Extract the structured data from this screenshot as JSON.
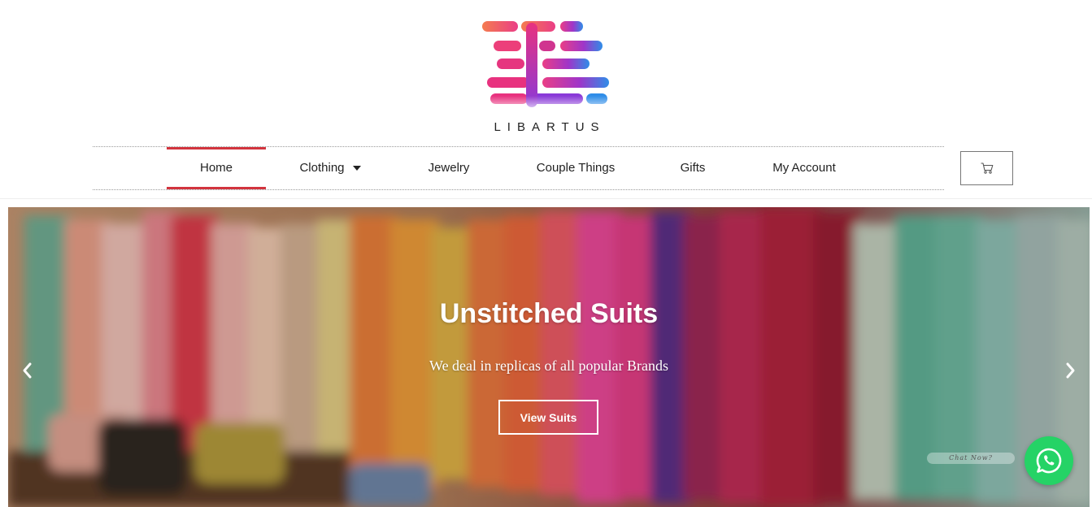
{
  "brand": {
    "name": "LIBARTUS",
    "logo_icon": "libartus-logo-icon",
    "colors": {
      "pink": "#e8327f",
      "purple": "#7b3fe0",
      "blue": "#2f8de8",
      "orange": "#f47b4f"
    }
  },
  "nav": {
    "items": [
      {
        "label": "Home",
        "active": true
      },
      {
        "label": "Clothing",
        "has_dropdown": true
      },
      {
        "label": "Jewelry"
      },
      {
        "label": "Couple Things"
      },
      {
        "label": "Gifts"
      },
      {
        "label": "My Account"
      }
    ],
    "active_color": "#d2343e",
    "cart_icon": "cart-icon"
  },
  "hero": {
    "title": "Unstitched Suits",
    "subtitle": "We deal in replicas of all popular Brands",
    "button_label": "View Suits",
    "prev_icon": "chevron-left-icon",
    "next_icon": "chevron-right-icon"
  },
  "chat": {
    "label": "Chat Now?",
    "icon": "whatsapp-icon",
    "color": "#25d366"
  }
}
